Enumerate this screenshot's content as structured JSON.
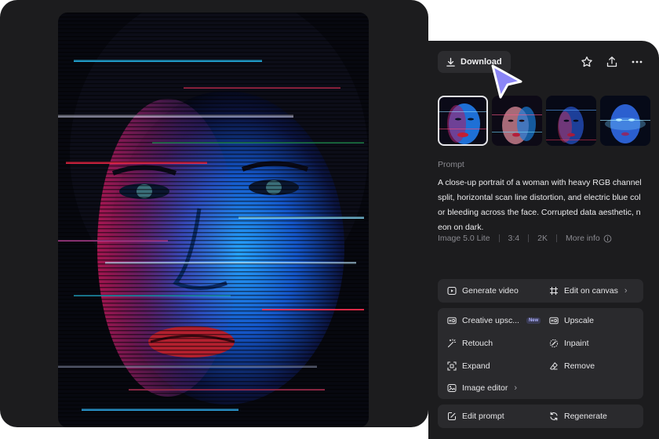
{
  "toolbar": {
    "download_label": "Download",
    "download_icon": "download-icon",
    "favorite_icon": "star-icon",
    "share_icon": "share-icon",
    "more_icon": "more-horizontal-icon"
  },
  "thumbnails": [
    {
      "alt": "variation 1",
      "selected": true
    },
    {
      "alt": "variation 2",
      "selected": false
    },
    {
      "alt": "variation 3",
      "selected": false
    },
    {
      "alt": "variation 4",
      "selected": false
    }
  ],
  "prompt": {
    "label": "Prompt",
    "text": "A close-up portrait of a woman with heavy RGB channel split, horizontal scan line distortion, and electric blue color bleeding across the face. Corrupted data aesthetic, neon on dark."
  },
  "meta": {
    "model": "Image 5.0 Lite",
    "ratio": "3:4",
    "resolution": "2K",
    "more_info": "More info"
  },
  "actions": {
    "generate_video": "Generate video",
    "edit_on_canvas": "Edit on canvas",
    "creative_upscale": "Creative upsc...",
    "new_badge": "New",
    "upscale": "Upscale",
    "retouch": "Retouch",
    "inpaint": "Inpaint",
    "expand": "Expand",
    "remove": "Remove",
    "image_editor": "Image editor",
    "edit_prompt": "Edit prompt",
    "regenerate": "Regenerate"
  },
  "colors": {
    "panel_bg": "#1c1c1e",
    "group_bg": "#2a2a2d",
    "cursor": "#8b86f7",
    "accent_blue": "#1f7fff",
    "accent_red": "#e0283a"
  }
}
